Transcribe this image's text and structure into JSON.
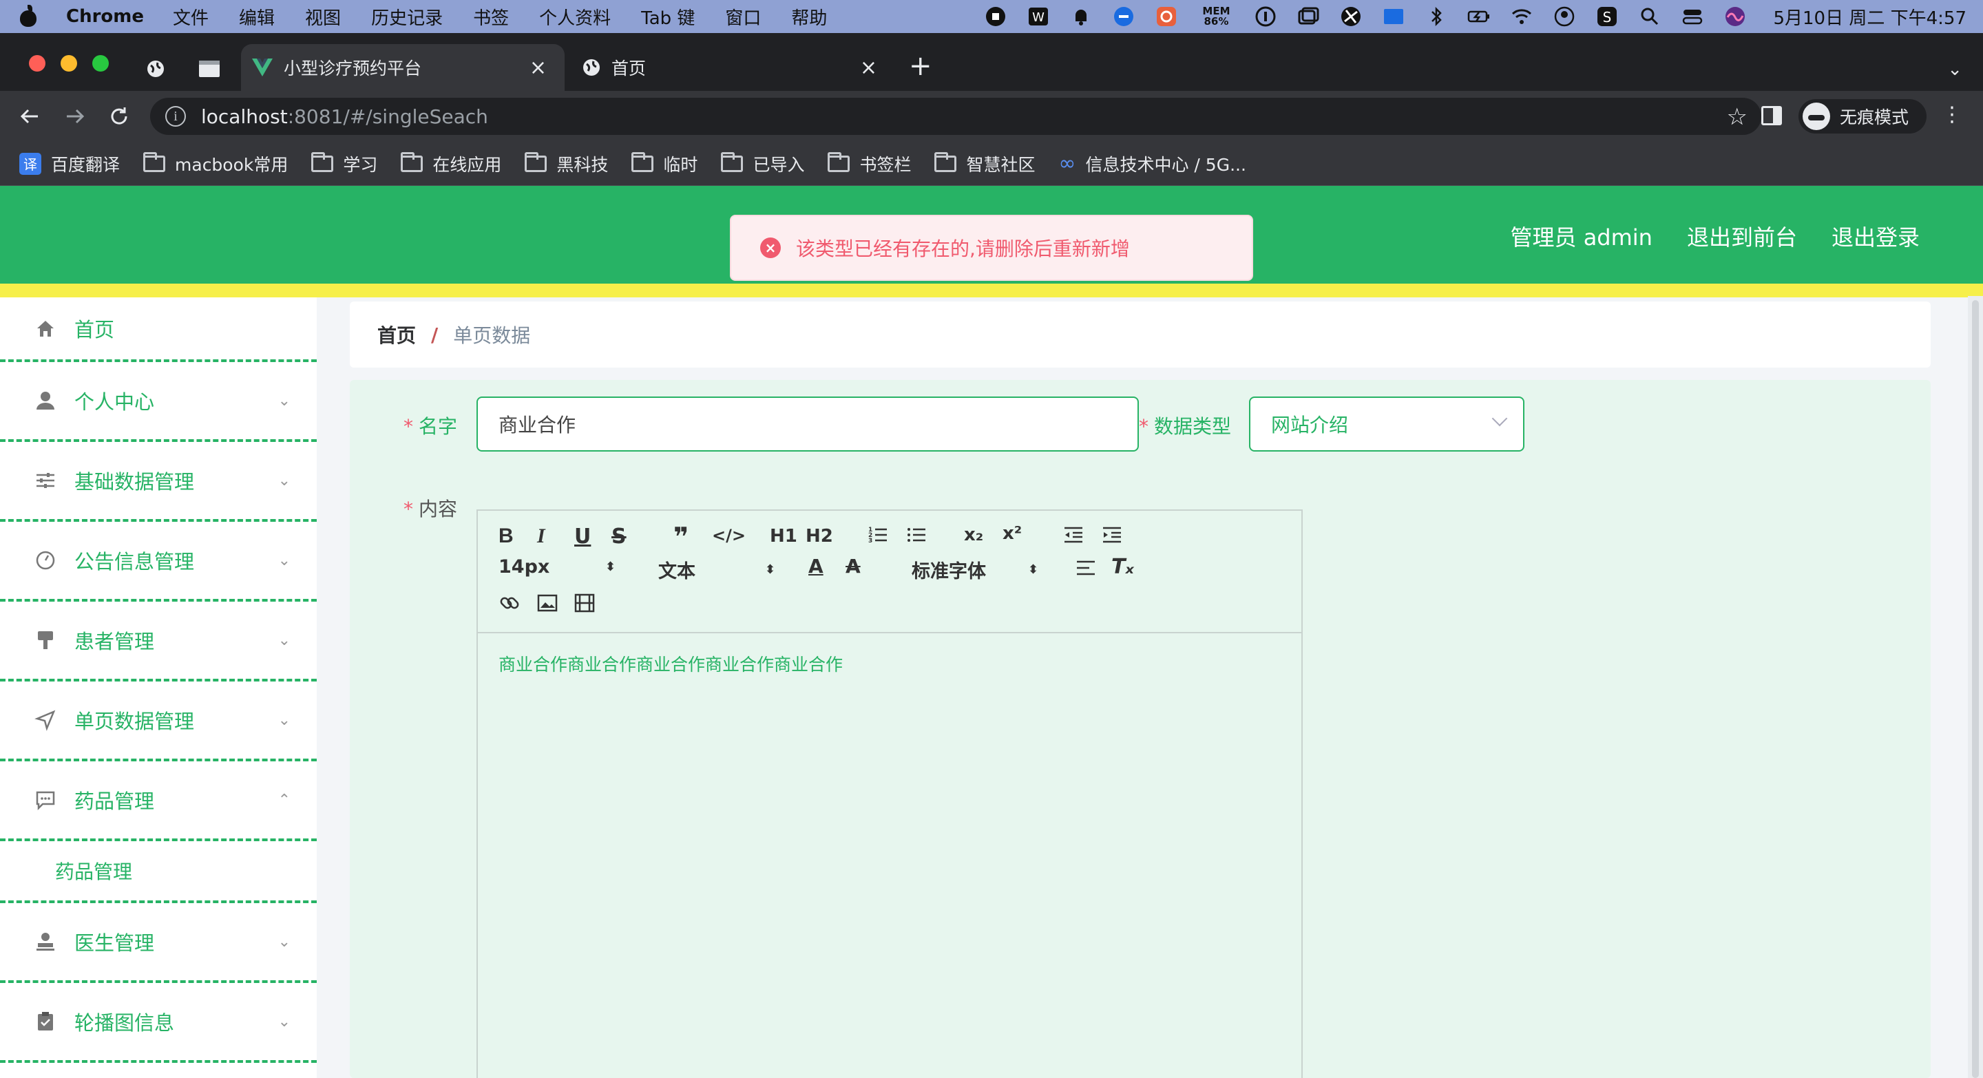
{
  "menubar": {
    "app_name": "Chrome",
    "items": [
      "文件",
      "编辑",
      "视图",
      "历史记录",
      "书签",
      "个人资料",
      "Tab 键",
      "窗口",
      "帮助"
    ],
    "mem_label": "MEM",
    "mem_value": "86%",
    "clock": "5月10日 周二 下午4:57"
  },
  "tabs": [
    {
      "title": "小型诊疗预约平台",
      "active": true,
      "close": "×"
    },
    {
      "title": "首页",
      "active": false,
      "close": "×"
    }
  ],
  "toolbar": {
    "url_host": "localhost",
    "url_path": ":8081/#/singleSeach",
    "incognito_label": "无痕模式"
  },
  "bookmarks": [
    "macbook常用",
    "学习",
    "在线应用",
    "黑科技",
    "临时",
    "已导入",
    "书签栏",
    "智慧社区"
  ],
  "bookmark_first": "百度翻译",
  "bookmark_baidu_glyph": "译",
  "bookmark_last": "信息技术中心 / 5G...",
  "app": {
    "topnav": [
      "管理员 admin",
      "退出到前台",
      "退出登录"
    ],
    "toast": "该类型已经有存在的,请删除后重新新增",
    "sidebar": [
      {
        "label": "首页",
        "icon": "home-icon",
        "chevron": ""
      },
      {
        "label": "个人中心",
        "icon": "user-icon",
        "chevron": "⌄"
      },
      {
        "label": "基础数据管理",
        "icon": "sliders-icon",
        "chevron": "⌄"
      },
      {
        "label": "公告信息管理",
        "icon": "gauge-icon",
        "chevron": "⌄"
      },
      {
        "label": "患者管理",
        "icon": "brush-icon",
        "chevron": "⌄"
      },
      {
        "label": "单页数据管理",
        "icon": "send-icon",
        "chevron": "⌄"
      },
      {
        "label": "药品管理",
        "icon": "chat-icon",
        "chevron": "⌃"
      },
      {
        "label": "医生管理",
        "icon": "stamp-icon",
        "chevron": "⌄"
      },
      {
        "label": "轮播图信息",
        "icon": "clipboard-icon",
        "chevron": "⌄"
      }
    ],
    "sidebar_sub": "药品管理",
    "breadcrumb": {
      "home": "首页",
      "sep": "/",
      "current": "单页数据"
    },
    "form": {
      "req_mark": "*",
      "name_label": "名字",
      "name_value": "商业合作",
      "type_label": "数据类型",
      "type_value": "网站介绍",
      "content_label": "内容",
      "editor": {
        "font_size": "14px",
        "heading": "文本",
        "font_family": "标准字体",
        "h1": "H1",
        "h2": "H2",
        "content": "商业合作商业合作商业合作商业合作商业合作"
      }
    }
  }
}
